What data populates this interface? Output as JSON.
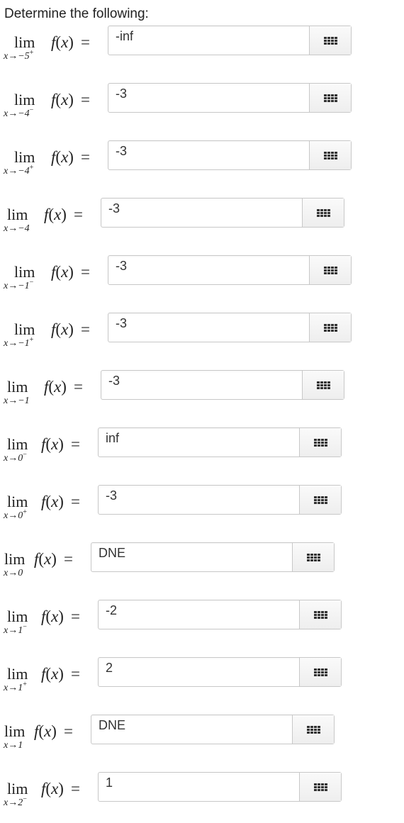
{
  "instruction": "Determine the following:",
  "rows": [
    {
      "approach": "x→−5",
      "side": "+",
      "value": "-inf"
    },
    {
      "approach": "x→−4",
      "side": "−",
      "value": "-3"
    },
    {
      "approach": "x→−4",
      "side": "+",
      "value": "-3"
    },
    {
      "approach": "x→−4",
      "side": "",
      "value": "-3"
    },
    {
      "approach": "x→−1",
      "side": "−",
      "value": "-3"
    },
    {
      "approach": "x→−1",
      "side": "+",
      "value": "-3"
    },
    {
      "approach": "x→−1",
      "side": "",
      "value": "-3"
    },
    {
      "approach": "x→0",
      "side": "−",
      "value": "inf"
    },
    {
      "approach": "x→0",
      "side": "+",
      "value": "-3"
    },
    {
      "approach": "x→0",
      "side": "",
      "value": "DNE"
    },
    {
      "approach": "x→1",
      "side": "−",
      "value": "-2"
    },
    {
      "approach": "x→1",
      "side": "+",
      "value": "2"
    },
    {
      "approach": "x→1",
      "side": "",
      "value": "DNE"
    },
    {
      "approach": "x→2",
      "side": "−",
      "value": "1"
    }
  ],
  "labels": {
    "lim": "lim",
    "fx_f": "f",
    "fx_x": "x",
    "equals": "="
  },
  "icons": {
    "keypad": "keypad-grid-icon"
  }
}
